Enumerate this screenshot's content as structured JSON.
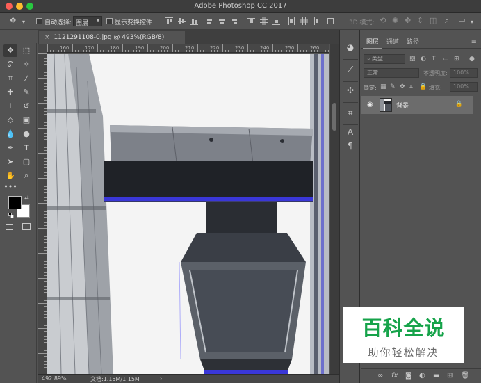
{
  "app": {
    "title": "Adobe Photoshop CC 2017"
  },
  "options_bar": {
    "auto_select_label": "自动选择:",
    "auto_select_value": "图层",
    "show_transform_label": "显示变换控件",
    "mode_3d_label": "3D 模式:"
  },
  "document": {
    "tab_title": "1121291108-0.jpg @ 493%(RGB/8)",
    "ruler_ticks": [
      "160",
      "170",
      "180",
      "190",
      "200",
      "210",
      "220",
      "230",
      "240",
      "250",
      "260"
    ]
  },
  "status_bar": {
    "zoom": "492.89%",
    "doc_info": "文档:1.15M/1.15M",
    "arrow": "›"
  },
  "layers_panel": {
    "tabs": [
      {
        "label": "图层",
        "active": true
      },
      {
        "label": "通道",
        "active": false
      },
      {
        "label": "路径",
        "active": false
      }
    ],
    "filter_kind": "类型",
    "blend_mode": "正常",
    "opacity_label": "不透明度:",
    "opacity_value": "100%",
    "lock_label": "锁定:",
    "fill_label": "填充:",
    "fill_value": "100%",
    "layers": [
      {
        "name": "背景",
        "locked": true,
        "visible": true
      }
    ]
  },
  "watermark": {
    "title": "百科全说",
    "subtitle": "助你轻松解决"
  },
  "colors": {
    "foreground": "#000000",
    "background": "#ffffff",
    "ui_bg": "#535353",
    "watermark_green": "#16a34a"
  }
}
